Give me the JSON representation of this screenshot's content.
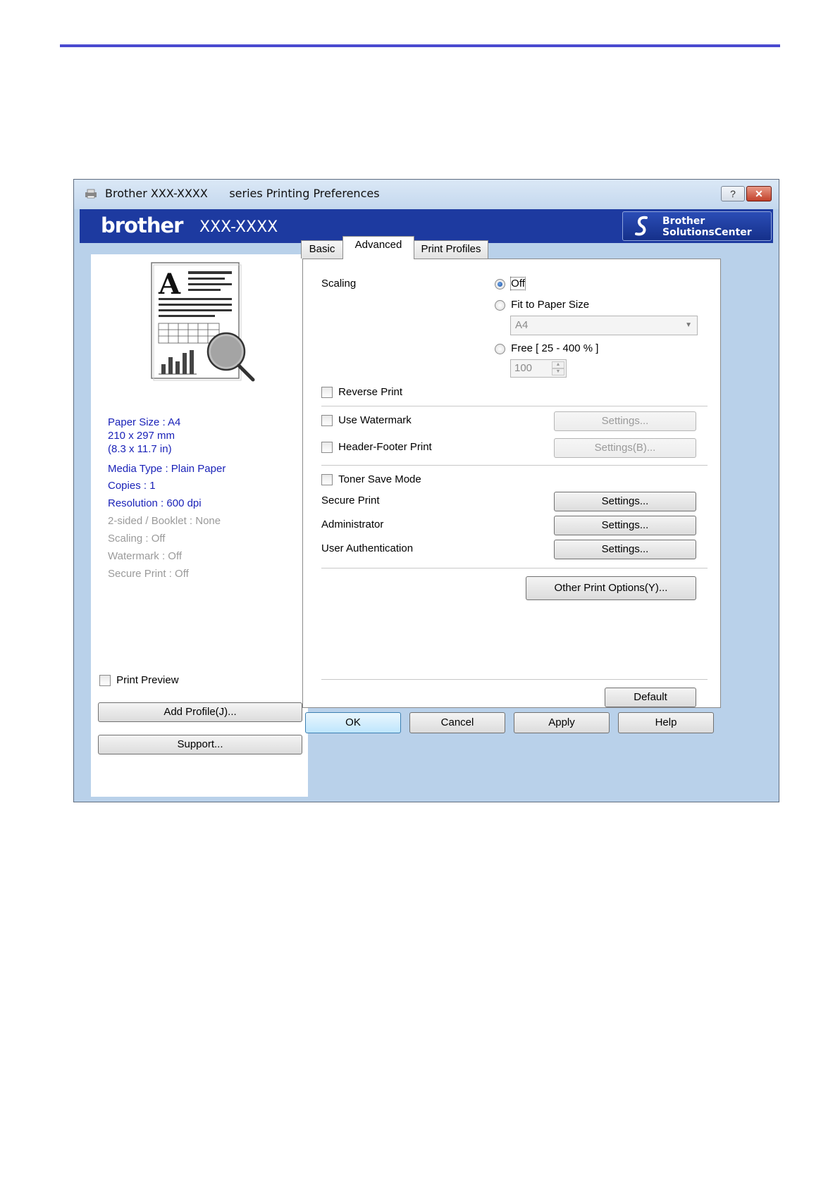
{
  "window": {
    "title": "Brother XXX-XXXX      series Printing Preferences",
    "help_label": "?",
    "close_label": "✕"
  },
  "banner": {
    "brand": "brother",
    "model": "XXX-XXXX",
    "solutions_line1": "Brother",
    "solutions_line2": "SolutionsCenter"
  },
  "left": {
    "info": [
      "Paper Size : A4",
      "210 x 297 mm",
      "(8.3 x 11.7 in)",
      "Media Type : Plain Paper",
      "Copies : 1",
      "Resolution : 600 dpi",
      "2-sided / Booklet : None",
      "Scaling : Off",
      "Watermark : Off",
      "Secure Print : Off"
    ],
    "print_preview_label": "Print Preview",
    "add_profile_label": "Add Profile(J)...",
    "support_label": "Support..."
  },
  "tabs": [
    "Basic",
    "Advanced",
    "Print Profiles"
  ],
  "advanced": {
    "scaling_label": "Scaling",
    "scaling_options": [
      "Off",
      "Fit to Paper Size",
      "Free [ 25 - 400 % ]"
    ],
    "scaling_selected": "Off",
    "paper_size_value": "A4",
    "free_value": "100",
    "reverse_print_label": "Reverse Print",
    "use_watermark_label": "Use Watermark",
    "watermark_settings_label": "Settings...",
    "header_footer_label": "Header-Footer Print",
    "header_footer_settings_label": "Settings(B)...",
    "toner_save_label": "Toner Save Mode",
    "secure_print_label": "Secure Print",
    "secure_print_settings_label": "Settings...",
    "administrator_label": "Administrator",
    "administrator_settings_label": "Settings...",
    "user_auth_label": "User Authentication",
    "user_auth_settings_label": "Settings...",
    "other_print_options_label": "Other Print Options(Y)...",
    "default_label": "Default"
  },
  "footer": {
    "ok_label": "OK",
    "cancel_label": "Cancel",
    "apply_label": "Apply",
    "help_label": "Help"
  },
  "colors": {
    "info_blue": "#1a22b8",
    "info_gray": "#9a9a9a",
    "banner": "#1d3aa0",
    "window_frame": "#b9d1ea",
    "top_rule": "#4a4ad0"
  }
}
